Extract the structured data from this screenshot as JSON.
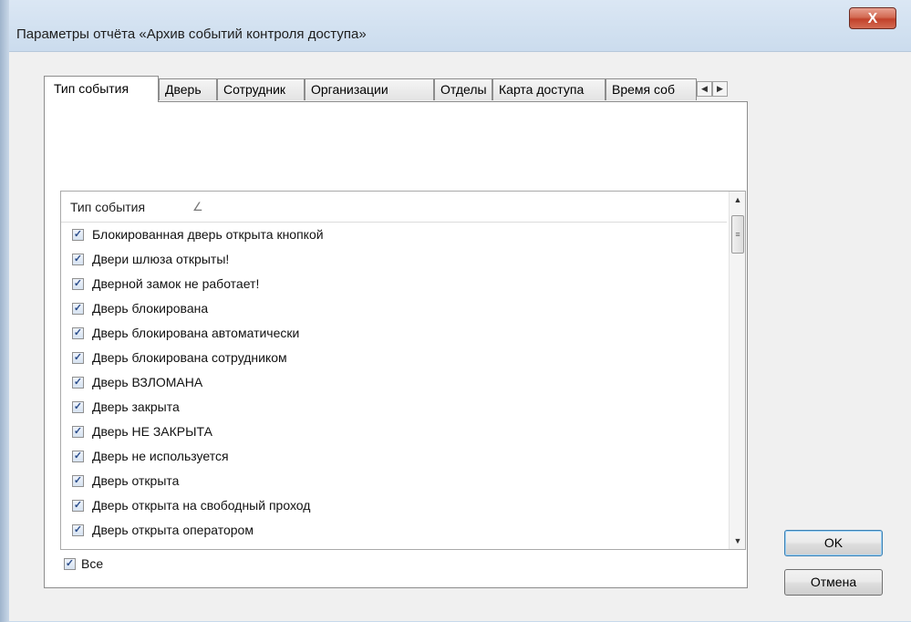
{
  "window": {
    "title": "Параметры отчёта «Архив событий контроля доступа»",
    "close_label": "X"
  },
  "tabs": [
    {
      "label": "Тип события",
      "active": true
    },
    {
      "label": "Дверь"
    },
    {
      "label": "Сотрудник"
    },
    {
      "label": "Организации"
    },
    {
      "label": "Отделы"
    },
    {
      "label": "Карта доступа"
    },
    {
      "label": "Время соб"
    }
  ],
  "list": {
    "header": "Тип события",
    "items": [
      {
        "label": "Блокированная дверь открыта кнопкой",
        "checked": true
      },
      {
        "label": "Двери шлюза открыты!",
        "checked": true
      },
      {
        "label": "Дверной замок не работает!",
        "checked": true
      },
      {
        "label": "Дверь блокирована",
        "checked": true
      },
      {
        "label": "Дверь блокирована автоматически",
        "checked": true
      },
      {
        "label": "Дверь блокирована сотрудником",
        "checked": true
      },
      {
        "label": "Дверь ВЗЛОМАНА",
        "checked": true
      },
      {
        "label": "Дверь закрыта",
        "checked": true
      },
      {
        "label": "Дверь НЕ ЗАКРЫТА",
        "checked": true
      },
      {
        "label": "Дверь не используется",
        "checked": true
      },
      {
        "label": "Дверь открыта",
        "checked": true
      },
      {
        "label": "Дверь открыта на свободный проход",
        "checked": true
      },
      {
        "label": "Дверь открыта оператором",
        "checked": true
      }
    ]
  },
  "all_checkbox": {
    "label": "Все",
    "checked": true
  },
  "buttons": {
    "ok": "OK",
    "cancel": "Отмена"
  },
  "colors": {
    "title_bar": "#c7d9ec",
    "close_button": "#c2412a",
    "dialog_bg": "#f0f0f0"
  }
}
